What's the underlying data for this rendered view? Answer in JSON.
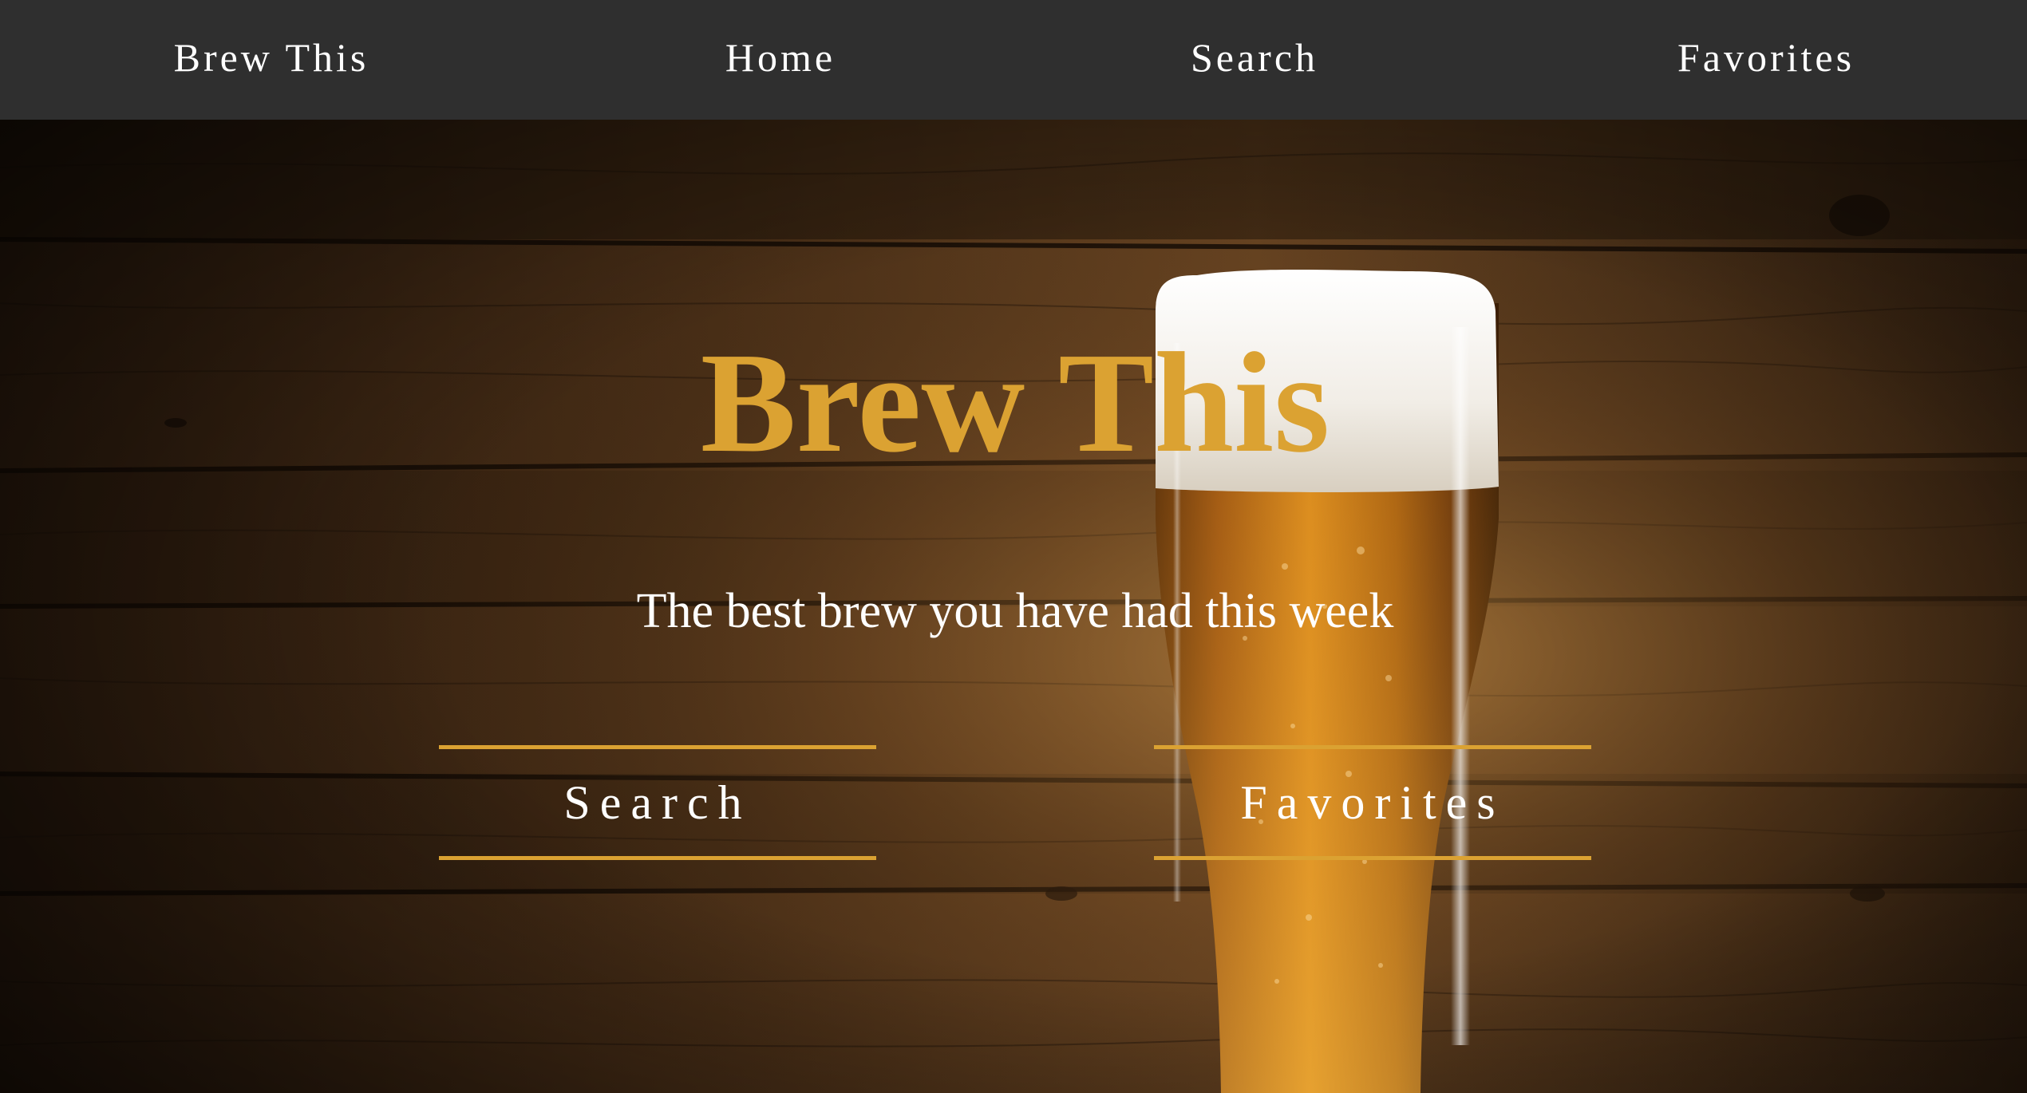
{
  "nav": {
    "brand": "Brew This",
    "home": "Home",
    "search": "Search",
    "favorites": "Favorites"
  },
  "hero": {
    "title": "Brew This",
    "tagline": "The best brew you have had this week",
    "buttons": {
      "search": "Search",
      "favorites": "Favorites"
    }
  },
  "colors": {
    "navbar": "#2f2f2f",
    "accent": "#dba232",
    "text": "#ffffff",
    "wood": "#3b2512"
  }
}
